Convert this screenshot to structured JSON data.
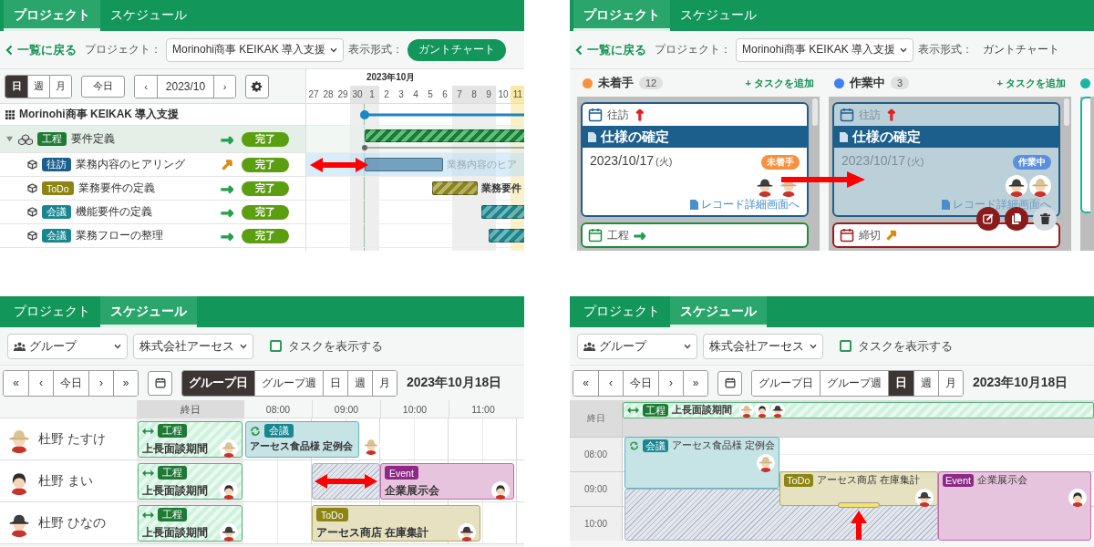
{
  "gantt_view": {
    "tabs": [
      {
        "label": "プロジェクト",
        "selected": true
      },
      {
        "label": "スケジュール",
        "selected": false
      }
    ],
    "back_link": "一覧に戻る",
    "project_label": "プロジェクト：",
    "project_select": "Morinohi商事 KEIKAK 導入支援",
    "view_label": "表示形式：",
    "view_options": [
      {
        "label": "ガントチャート",
        "selected": true
      }
    ],
    "scale_tabs": [
      {
        "label": "日",
        "selected": true
      },
      {
        "label": "週",
        "selected": false
      },
      {
        "label": "月",
        "selected": false
      }
    ],
    "today_button": "今日",
    "period_prev": "‹",
    "period": "2023/10",
    "period_next": "›",
    "month_header": "2023年10月",
    "days": [
      {
        "label": "27",
        "kind": "weekday"
      },
      {
        "label": "28",
        "kind": "weekday"
      },
      {
        "label": "29",
        "kind": "weekday"
      },
      {
        "label": "30",
        "kind": "holiday"
      },
      {
        "label": "1",
        "kind": "holiday"
      },
      {
        "label": "2",
        "kind": "weekday"
      },
      {
        "label": "3",
        "kind": "weekday"
      },
      {
        "label": "4",
        "kind": "weekday"
      },
      {
        "label": "5",
        "kind": "weekday"
      },
      {
        "label": "6",
        "kind": "weekday"
      },
      {
        "label": "7",
        "kind": "holiday"
      },
      {
        "label": "8",
        "kind": "holiday"
      },
      {
        "label": "9",
        "kind": "holiday"
      },
      {
        "label": "10",
        "kind": "weekday"
      },
      {
        "label": "11",
        "kind": "today"
      }
    ],
    "project": {
      "name": "Morinohi商事 KEIKAK 導入支援"
    },
    "phases": [
      {
        "tag": {
          "label": "工程",
          "color": "#1f7a36"
        },
        "name": "要件定義",
        "trend": {
          "symbol": "→",
          "color": "#22a04b"
        },
        "status": "完了",
        "expanded": true,
        "children": [
          {
            "tag": {
              "label": "往訪",
              "color": "#1d5f8c"
            },
            "name": "業務内容のヒアリング",
            "trend": {
              "symbol": "↗",
              "color": "#d98b0b"
            },
            "status": "完了",
            "selected": true,
            "bar_label": "業務内容のヒア"
          },
          {
            "tag": {
              "label": "ToDo",
              "color": "#8c8414"
            },
            "name": "業務要件の定義",
            "trend": {
              "symbol": "→",
              "color": "#22a04b"
            },
            "status": "完了",
            "selected": false,
            "bar_label": "業務要件"
          },
          {
            "tag": {
              "label": "会議",
              "color": "#17868f"
            },
            "name": "機能要件の定義",
            "trend": {
              "symbol": "→",
              "color": "#22a04b"
            },
            "status": "完了",
            "selected": false
          },
          {
            "tag": {
              "label": "会議",
              "color": "#17868f"
            },
            "name": "業務フローの整理",
            "trend": {
              "symbol": "→",
              "color": "#22a04b"
            },
            "status": "完了",
            "selected": false
          }
        ]
      }
    ]
  },
  "kanban_view": {
    "tabs": [
      {
        "label": "プロジェクト",
        "selected": true
      },
      {
        "label": "スケジュール",
        "selected": false
      }
    ],
    "back_link": "一覧に戻る",
    "project_label": "プロジェクト：",
    "project_select": "Morinohi商事 KEIKAK 導入支援",
    "view_label": "表示形式：",
    "view_options": [
      {
        "label": "ガントチャート",
        "selected": false
      }
    ],
    "columns": [
      {
        "name": "未着手",
        "color": "#f7913d",
        "count": "12",
        "add_link": "+ タスクを追加",
        "cards": [
          {
            "type": {
              "label": "往訪",
              "color": "#1d5f8c"
            },
            "priority": {
              "symbol": "↑",
              "color": "#e02020"
            },
            "title": "仕様の確定",
            "date": "2023/10/17",
            "weekday": "(火)",
            "status": {
              "label": "未着手",
              "color": "#f7913d"
            },
            "avatars": [
              {
                "kind": "brimhat"
              },
              {
                "kind": "strawhat"
              }
            ],
            "link": "レコード詳細画面へ",
            "dragging": false,
            "hovered": false
          },
          {
            "type": {
              "label": "工程",
              "color": "#1e8e3e"
            },
            "priority": {
              "symbol": "→",
              "color": "#22a04b"
            },
            "dragging": false,
            "hovered": false
          }
        ]
      },
      {
        "name": "作業中",
        "color": "#3b82f6",
        "count": "3",
        "add_link": "+ タスクを追加",
        "cards": [
          {
            "type": {
              "label": "往訪",
              "color": "#1d5f8c"
            },
            "priority": {
              "symbol": "↑",
              "color": "#e02020"
            },
            "title": "仕様の確定",
            "date": "2023/10/17",
            "weekday": "(火)",
            "status": {
              "label": "作業中",
              "color": "#5b8fe0"
            },
            "avatars": [
              {
                "kind": "brimhat"
              },
              {
                "kind": "strawhat"
              }
            ],
            "link": "レコード詳細画面へ",
            "dragging": true,
            "hovered": false
          },
          {
            "type": {
              "label": "締切",
              "color": "#9b1c1c"
            },
            "priority": {
              "symbol": "↗",
              "color": "#d98b0b"
            },
            "dragging": false,
            "hovered": true
          }
        ]
      },
      {
        "color": "#1bb3a4"
      }
    ]
  },
  "group_schedule_view": {
    "tabs": [
      {
        "label": "プロジェクト",
        "selected": false
      },
      {
        "label": "スケジュール",
        "selected": true
      }
    ],
    "group_select": "グループ",
    "company_select": "株式会社アーセス",
    "show_tasks": {
      "label": "タスクを表示する",
      "checked": false
    },
    "nav_buttons": [
      "«",
      "‹",
      "今日",
      "›",
      "»"
    ],
    "views": [
      {
        "label": "グループ日",
        "selected": true
      },
      {
        "label": "グループ週",
        "selected": false
      },
      {
        "label": "日",
        "selected": false
      },
      {
        "label": "週",
        "selected": false
      },
      {
        "label": "月",
        "selected": false
      }
    ],
    "date": "2023年10月18日",
    "all_day_header": "終日",
    "hours": [
      "08:00",
      "09:00",
      "10:00",
      "11:00"
    ],
    "members": [
      {
        "name": "杜野 たすけ",
        "avatar": {
          "kind": "strawhat"
        },
        "all_day": {
          "kind": "span",
          "tag": {
            "label": "工程",
            "color": "#1f7a36"
          },
          "title": "上長面談期間",
          "avatars": [
            {
              "kind": "strawhat"
            }
          ]
        },
        "events": [
          {
            "kind": "meeting",
            "tag": {
              "label": "会議",
              "color": "#17868f"
            },
            "title": "アーセス食品様 定例会",
            "avatars": [
              {
                "kind": "strawhat"
              }
            ]
          }
        ]
      },
      {
        "name": "杜野 まい",
        "avatar": {
          "kind": "cap"
        },
        "all_day": {
          "kind": "span",
          "tag": {
            "label": "工程",
            "color": "#1f7a36"
          },
          "title": "上長面談期間",
          "avatars": [
            {
              "kind": "cap"
            }
          ]
        },
        "events": [
          {
            "kind": "ghost"
          },
          {
            "kind": "event",
            "tag": {
              "label": "Event",
              "color": "#8d2a85"
            },
            "title": "企業展示会",
            "avatars": [
              {
                "kind": "cap"
              }
            ]
          }
        ]
      },
      {
        "name": "杜野 ひなの",
        "avatar": {
          "kind": "brimhat"
        },
        "all_day": {
          "kind": "span",
          "tag": {
            "label": "工程",
            "color": "#1f7a36"
          },
          "title": "上長面談期間",
          "avatars": [
            {
              "kind": "brimhat"
            }
          ]
        },
        "events": [
          {
            "kind": "todo",
            "tag": {
              "label": "ToDo",
              "color": "#8c8414"
            },
            "title": "アーセス商店 在庫集計",
            "avatars": [
              {
                "kind": "brimhat"
              }
            ]
          }
        ]
      }
    ]
  },
  "day_schedule_view": {
    "tabs": [
      {
        "label": "プロジェクト",
        "selected": false
      },
      {
        "label": "スケジュール",
        "selected": true
      }
    ],
    "group_select": "グループ",
    "company_select": "株式会社アーセス",
    "show_tasks": {
      "label": "タスクを表示する",
      "checked": false
    },
    "nav_buttons": [
      "«",
      "‹",
      "今日",
      "›",
      "»"
    ],
    "views": [
      {
        "label": "グループ日",
        "selected": false
      },
      {
        "label": "グループ週",
        "selected": false
      },
      {
        "label": "日",
        "selected": true
      },
      {
        "label": "週",
        "selected": false
      },
      {
        "label": "月",
        "selected": false
      }
    ],
    "date": "2023年10月18日",
    "all_day_header": "終日",
    "all_day_events": [
      {
        "kind": "span",
        "tag": {
          "label": "工程",
          "color": "#1f7a36"
        },
        "title": "上長面談期間",
        "avatars": [
          {
            "kind": "strawhat"
          },
          {
            "kind": "cap"
          },
          {
            "kind": "brimhat"
          }
        ]
      }
    ],
    "hours": [
      "08:00",
      "09:00",
      "10:00"
    ],
    "events": [
      {
        "kind": "ghost"
      },
      {
        "kind": "meeting",
        "tag": {
          "label": "会議",
          "color": "#17868f"
        },
        "title": "アーセス食品様 定例会",
        "avatars": [
          {
            "kind": "strawhat"
          }
        ],
        "resizing": false
      },
      {
        "kind": "todo",
        "tag": {
          "label": "ToDo",
          "color": "#8c8414"
        },
        "title": "アーセス商店 在庫集計",
        "avatars": [
          {
            "kind": "brimhat"
          }
        ],
        "resizing": true
      },
      {
        "kind": "event",
        "tag": {
          "label": "Event",
          "color": "#8d2a85"
        },
        "title": "企業展示会",
        "avatars": [
          {
            "kind": "cap"
          }
        ],
        "resizing": false
      }
    ]
  }
}
